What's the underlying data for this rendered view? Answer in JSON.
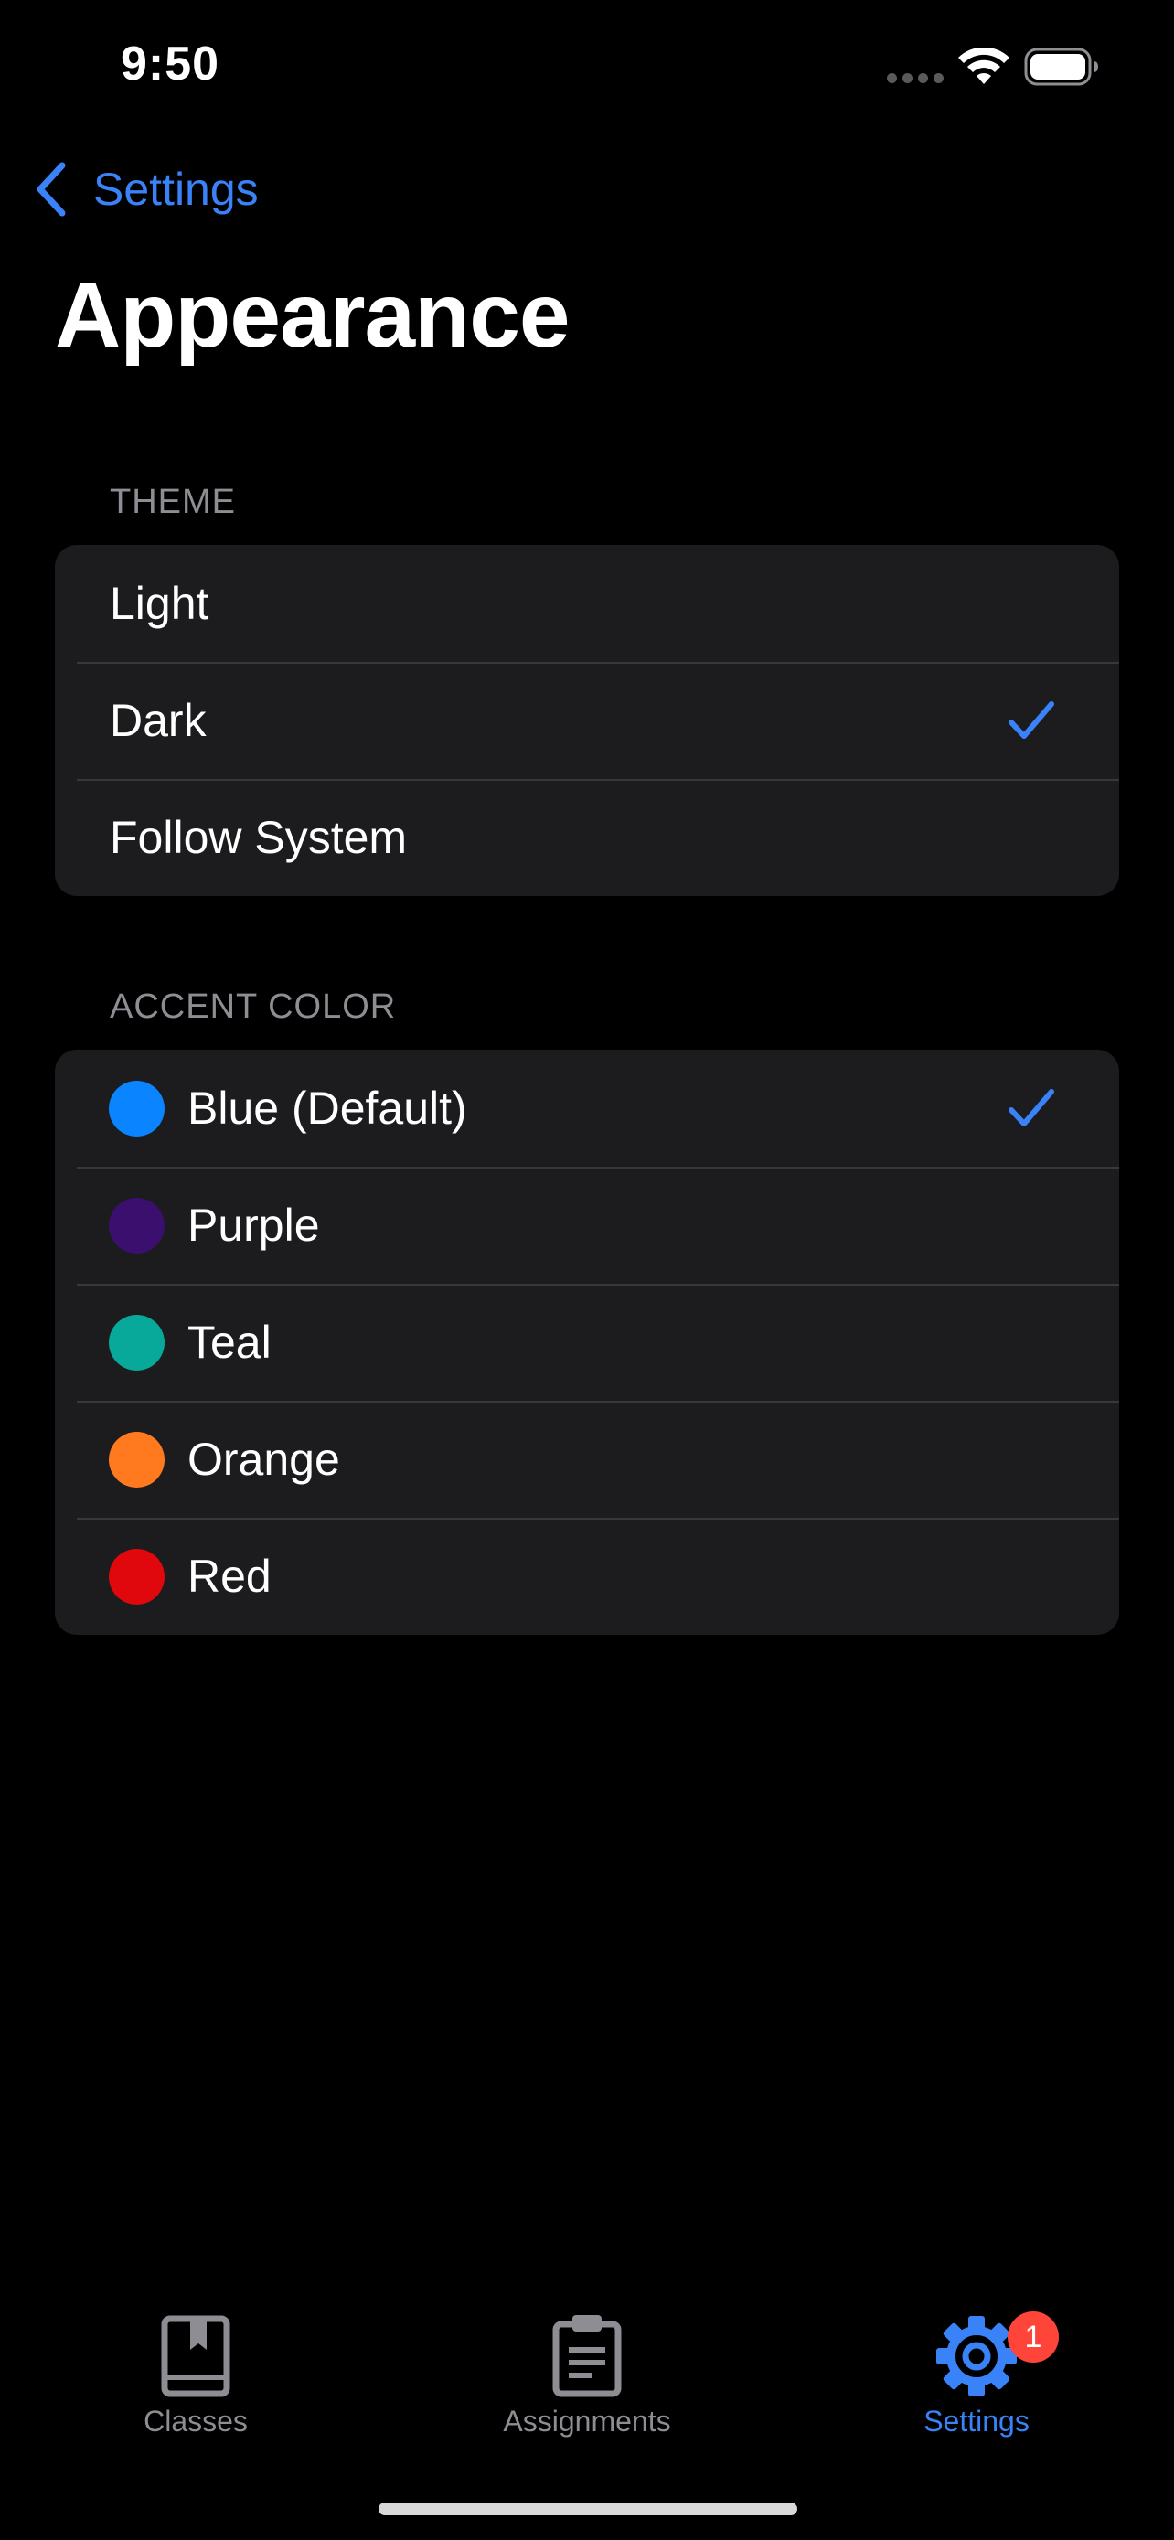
{
  "status_bar": {
    "time": "9:50",
    "icons": [
      "cellular-signal-icon",
      "wifi-icon",
      "battery-icon"
    ]
  },
  "navigation": {
    "back_label": "Settings",
    "back_icon": "chevron-left-icon",
    "title": "Appearance"
  },
  "theme_section": {
    "header": "THEME",
    "options": [
      {
        "label": "Light",
        "selected": false
      },
      {
        "label": "Dark",
        "selected": true
      },
      {
        "label": "Follow System",
        "selected": false
      }
    ]
  },
  "accent_section": {
    "header": "ACCENT COLOR",
    "options": [
      {
        "label": "Blue (Default)",
        "color": "#0a84ff",
        "selected": true
      },
      {
        "label": "Purple",
        "color": "#3a0f6e",
        "selected": false
      },
      {
        "label": "Teal",
        "color": "#08a89a",
        "selected": false
      },
      {
        "label": "Orange",
        "color": "#ff7a1f",
        "selected": false
      },
      {
        "label": "Red",
        "color": "#e0070d",
        "selected": false
      }
    ]
  },
  "tab_bar": {
    "tabs": [
      {
        "label": "Classes",
        "icon": "book-icon",
        "active": false
      },
      {
        "label": "Assignments",
        "icon": "clipboard-icon",
        "active": false
      },
      {
        "label": "Settings",
        "icon": "gear-icon",
        "active": true,
        "badge": "1"
      }
    ]
  },
  "colors": {
    "accent": "#3a82f7",
    "background": "#000000",
    "group_background": "#1c1c1e",
    "secondary_text": "#8d8d93",
    "badge": "#ff453a"
  }
}
